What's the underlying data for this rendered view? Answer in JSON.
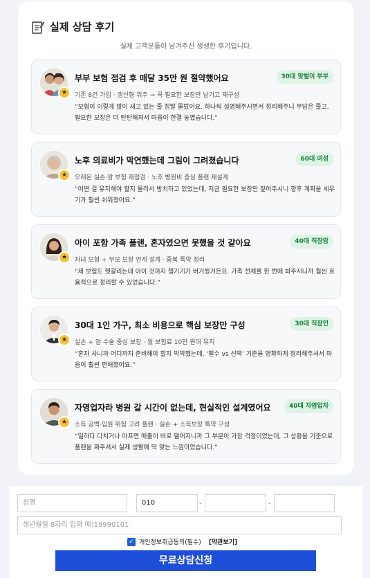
{
  "section": {
    "title": "실제 상담 후기",
    "subtitle": "실제 고객분들이 남겨주신 생생한 후기입니다."
  },
  "reviews": [
    {
      "title": "부부 보험 점검 후 매달 35만 원 절약했어요",
      "badge": "30대 맞벌이 부부",
      "meta": "기존 8건 가입 · 갱신형 위주 → 꼭 필요한 보장만 남기고 재구성",
      "quote": "“보험이 이렇게 많이 새고 있는 줄 정말 몰랐어요. 하나씩 설명해주시면서 정리해주니 부담은 줄고, 필요한 보장은 더 탄탄해져서 마음이 한결 놓였습니다.”",
      "avatar": "couple-avatar"
    },
    {
      "title": "노후 의료비가 막연했는데 그림이 그려졌습니다",
      "badge": "60대 여성",
      "meta": "오래된 실손·암 보험 재점검 · 노후 병원비 중심 플랜 재설계",
      "quote": "“어떤 걸 유지해야 할지 몰라서 방치하고 있었는데, 지금 필요한 보장만 짚어주시니 향후 계획을 세우기가 훨씬 쉬워졌어요.”",
      "avatar": "senior-woman-avatar"
    },
    {
      "title": "아이 포함 가족 플랜, 혼자였으면 못했을 것 같아요",
      "badge": "40대 직장맘",
      "meta": "자녀 보험 + 부모 보장 연계 설계 · 중복 특약 정리",
      "quote": "“제 보험도 헷갈리는데 아이 것까지 챙기기가 버거웠거든요. 가족 전체를 한 번에 봐주시니까 훨씬 효율적으로 정리할 수 있었습니다.”",
      "avatar": "mother-avatar"
    },
    {
      "title": "30대 1인 가구, 최소 비용으로 핵심 보장만 구성",
      "badge": "30대 직장인",
      "meta": "실손 + 암·수술 중심 보장 · 월 보험료 10만 원대 유지",
      "quote": "“혼자 사니까 어디까지 준비해야 할지 막막했는데, ‘필수 vs 선택’ 기준을 명확하게 정리해주셔서 마음이 훨씬 편해졌어요.”",
      "avatar": "young-man-avatar"
    },
    {
      "title": "자영업자라 병원 갈 시간이 없는데, 현실적인 설계였어요",
      "badge": "40대 자영업자",
      "meta": "소득 공백·입원 위험 고려 플랜 · 실손 + 소득보장 특약 구성",
      "quote": "“일하다 다치거나 아프면 매출이 바로 떨어지니까 그 부분이 가장 걱정이었는데, 그 상황을 기준으로 플랜을 짜주셔서 실제 생활에 딱 맞는 느낌이었습니다.”",
      "avatar": "business-owner-avatar"
    }
  ],
  "form": {
    "name_placeholder": "성명",
    "phone_prefix": "010",
    "phone_mid": "",
    "phone_last": "",
    "phone_separator": "-",
    "birth_placeholder": "생년월일 8자리 입력 예)19990101",
    "agree_label": "개인정보취급동의(필수)",
    "terms_link": "[약관보기]",
    "submit_label": "무료상담신청"
  },
  "colors": {
    "badge_bg": "#dff3e6",
    "badge_text": "#17803d",
    "star": "#f6c237",
    "submit_bg": "#1f4fd8",
    "checkbox": "#1b5fd1"
  },
  "icons": {
    "section_icon": "memo-pencil-icon",
    "star_icon": "star-icon",
    "checkbox_icon": "checkmark-icon"
  }
}
